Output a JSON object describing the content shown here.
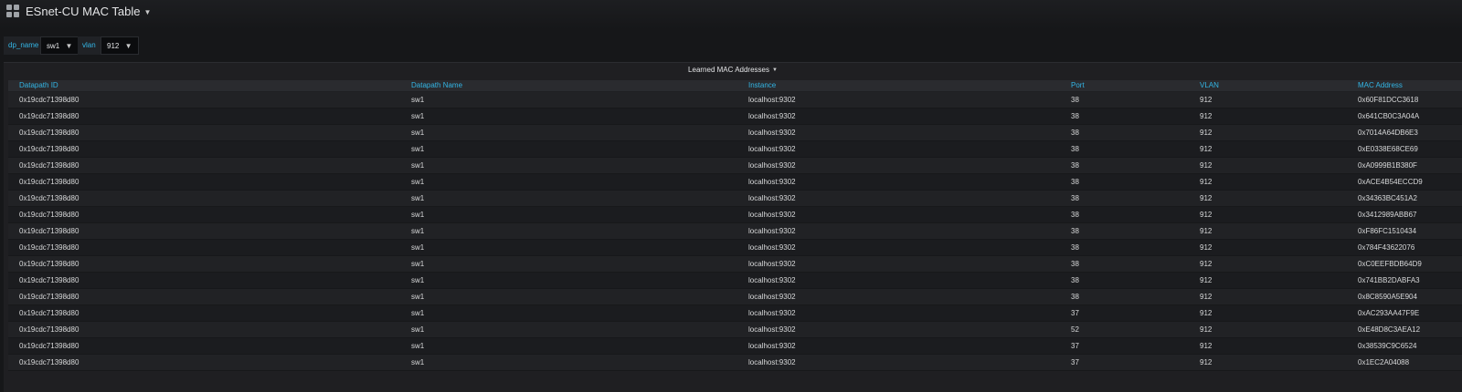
{
  "header": {
    "title": "ESnet-CU MAC Table"
  },
  "variables": [
    {
      "label": "dp_name",
      "value": "sw1"
    },
    {
      "label": "vlan",
      "value": "912"
    }
  ],
  "panel": {
    "title": "Learned MAC Addresses",
    "columns": [
      "Datapath ID",
      "Datapath Name",
      "Instance",
      "Port",
      "VLAN",
      "MAC Address"
    ],
    "rows": [
      [
        "0x19cdc71398d80",
        "sw1",
        "localhost:9302",
        "38",
        "912",
        "0x60F81DCC3618"
      ],
      [
        "0x19cdc71398d80",
        "sw1",
        "localhost:9302",
        "38",
        "912",
        "0x641CB0C3A04A"
      ],
      [
        "0x19cdc71398d80",
        "sw1",
        "localhost:9302",
        "38",
        "912",
        "0x7014A64DB6E3"
      ],
      [
        "0x19cdc71398d80",
        "sw1",
        "localhost:9302",
        "38",
        "912",
        "0xE0338E68CE69"
      ],
      [
        "0x19cdc71398d80",
        "sw1",
        "localhost:9302",
        "38",
        "912",
        "0xA0999B1B380F"
      ],
      [
        "0x19cdc71398d80",
        "sw1",
        "localhost:9302",
        "38",
        "912",
        "0xACE4B54ECCD9"
      ],
      [
        "0x19cdc71398d80",
        "sw1",
        "localhost:9302",
        "38",
        "912",
        "0x34363BC451A2"
      ],
      [
        "0x19cdc71398d80",
        "sw1",
        "localhost:9302",
        "38",
        "912",
        "0x3412989ABB67"
      ],
      [
        "0x19cdc71398d80",
        "sw1",
        "localhost:9302",
        "38",
        "912",
        "0xF86FC1510434"
      ],
      [
        "0x19cdc71398d80",
        "sw1",
        "localhost:9302",
        "38",
        "912",
        "0x784F43622076"
      ],
      [
        "0x19cdc71398d80",
        "sw1",
        "localhost:9302",
        "38",
        "912",
        "0xC0EEFBDB64D9"
      ],
      [
        "0x19cdc71398d80",
        "sw1",
        "localhost:9302",
        "38",
        "912",
        "0x741BB2DABFA3"
      ],
      [
        "0x19cdc71398d80",
        "sw1",
        "localhost:9302",
        "38",
        "912",
        "0x8C8590A5E904"
      ],
      [
        "0x19cdc71398d80",
        "sw1",
        "localhost:9302",
        "37",
        "912",
        "0xAC293AA47F9E"
      ],
      [
        "0x19cdc71398d80",
        "sw1",
        "localhost:9302",
        "52",
        "912",
        "0xE48D8C3AEA12"
      ],
      [
        "0x19cdc71398d80",
        "sw1",
        "localhost:9302",
        "37",
        "912",
        "0x38539C9C6524"
      ],
      [
        "0x19cdc71398d80",
        "sw1",
        "localhost:9302",
        "37",
        "912",
        "0x1EC2A04088"
      ]
    ]
  }
}
